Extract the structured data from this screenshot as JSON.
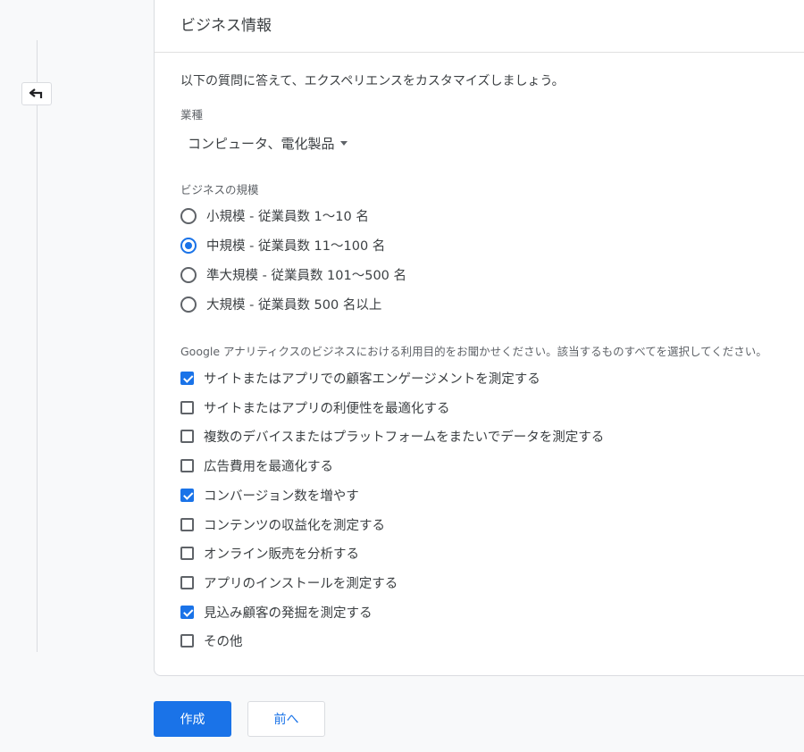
{
  "card": {
    "title": "ビジネス情報",
    "intro": "以下の質問に答えて、エクスペリエンスをカスタマイズしましょう。"
  },
  "industry": {
    "label": "業種",
    "selected": "コンピュータ、電化製品"
  },
  "business_size": {
    "label": "ビジネスの規模",
    "options": [
      {
        "label": "小規模 - 従業員数 1～10 名",
        "selected": false
      },
      {
        "label": "中規模 - 従業員数 11～100 名",
        "selected": true
      },
      {
        "label": "準大規模 - 従業員数 101～500 名",
        "selected": false
      },
      {
        "label": "大規模 - 従業員数 500 名以上",
        "selected": false
      }
    ]
  },
  "usage": {
    "label": "Google アナリティクスのビジネスにおける利用目的をお聞かせください。該当するものすべてを選択してください。",
    "options": [
      {
        "label": "サイトまたはアプリでの顧客エンゲージメントを測定する",
        "checked": true
      },
      {
        "label": "サイトまたはアプリの利便性を最適化する",
        "checked": false
      },
      {
        "label": "複数のデバイスまたはプラットフォームをまたいでデータを測定する",
        "checked": false
      },
      {
        "label": "広告費用を最適化する",
        "checked": false
      },
      {
        "label": "コンバージョン数を増やす",
        "checked": true
      },
      {
        "label": "コンテンツの収益化を測定する",
        "checked": false
      },
      {
        "label": "オンライン販売を分析する",
        "checked": false
      },
      {
        "label": "アプリのインストールを測定する",
        "checked": false
      },
      {
        "label": "見込み顧客の発掘を測定する",
        "checked": true
      },
      {
        "label": "その他",
        "checked": false
      }
    ]
  },
  "buttons": {
    "create": "作成",
    "previous": "前へ"
  },
  "colors": {
    "accent": "#1a73e8",
    "border": "#dadce0",
    "text": "#3c4043"
  },
  "icons": {
    "back": "back-arrow-icon",
    "dropdown": "caret-down-icon"
  }
}
